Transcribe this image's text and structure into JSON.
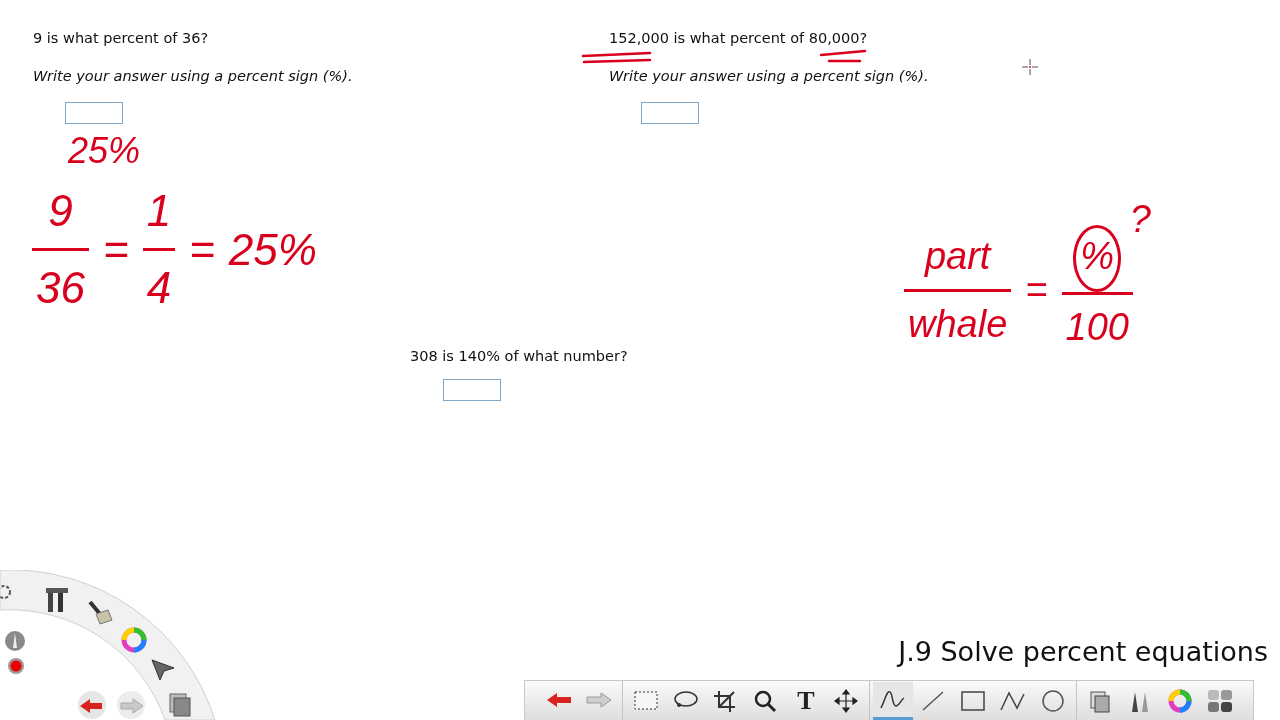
{
  "problems": [
    {
      "question": "9 is what percent of 36?",
      "instruction": "Write your answer using a percent sign (%)."
    },
    {
      "question": "152,000 is what percent of 80,000?",
      "instruction": "Write your answer using a percent sign (%)."
    },
    {
      "question": "308 is 140% of what number?"
    }
  ],
  "ink": [
    {
      "kind": "text",
      "text": "25%"
    },
    {
      "kind": "equation",
      "parts": [
        {
          "kind": "fraction",
          "num": "9",
          "den": "36"
        },
        {
          "kind": "symbol",
          "text": "="
        },
        {
          "kind": "fraction",
          "num": "1",
          "den": "4"
        },
        {
          "kind": "symbol",
          "text": "="
        },
        {
          "kind": "symbol",
          "text": "25%"
        }
      ]
    },
    {
      "kind": "equation",
      "parts": [
        {
          "kind": "fraction",
          "num": "part",
          "den": "whale"
        },
        {
          "kind": "symbol",
          "text": "="
        },
        {
          "kind": "fraction",
          "num": "%",
          "den": "100",
          "circled": true,
          "note": "?"
        }
      ]
    }
  ],
  "lesson_title": "J.9 Solve percent equations",
  "toolbar": [
    {
      "kind": "undo",
      "selected": false
    },
    {
      "kind": "redo",
      "selected": false
    },
    {
      "kind": "divider"
    },
    {
      "kind": "select",
      "selected": false
    },
    {
      "kind": "lasso",
      "selected": false
    },
    {
      "kind": "crop",
      "selected": false
    },
    {
      "kind": "zoom",
      "selected": false
    },
    {
      "kind": "text",
      "label": "T",
      "selected": false
    },
    {
      "kind": "move",
      "selected": false
    },
    {
      "kind": "divider"
    },
    {
      "kind": "pen",
      "selected": true
    },
    {
      "kind": "line",
      "selected": false
    },
    {
      "kind": "rect",
      "selected": false
    },
    {
      "kind": "polyline",
      "selected": false
    },
    {
      "kind": "ellipse",
      "selected": false
    },
    {
      "kind": "divider"
    },
    {
      "kind": "pages",
      "selected": false
    },
    {
      "kind": "pencils",
      "selected": false
    },
    {
      "kind": "color",
      "selected": false
    },
    {
      "kind": "palette",
      "selected": false
    }
  ]
}
